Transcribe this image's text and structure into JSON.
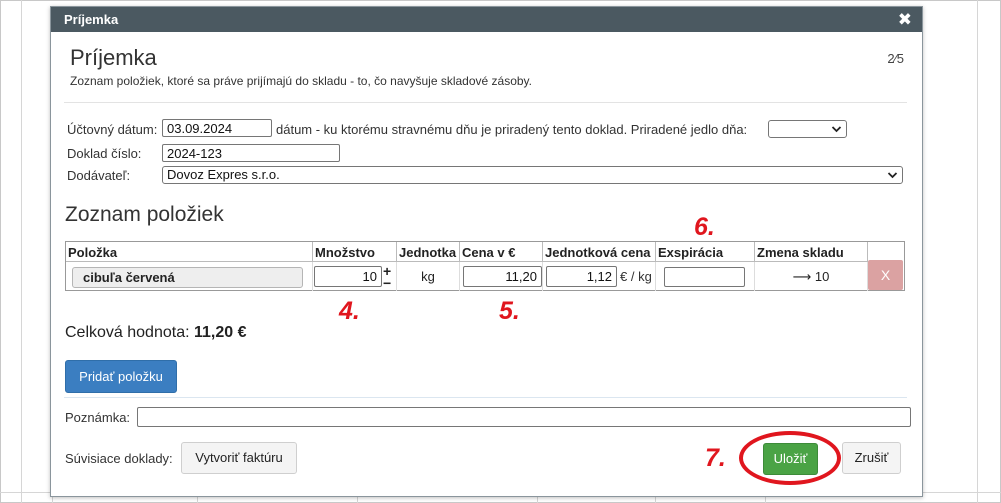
{
  "dialog": {
    "title_bar": "Príjemka",
    "close_glyph": "✖",
    "heading": "Príjemka",
    "subtitle": "Zoznam položiek, ktoré sa práve prijímajú do skladu - to, čo navyšuje skladové zásoby.",
    "step": "2⁄5"
  },
  "form": {
    "date_label": "Účtovný dátum:",
    "date_value": "03.09.2024",
    "date_hint": "dátum - ku ktorému stravnému dňu je priradený tento doklad. Priradené jedlo dňa:",
    "meal_select_value": "",
    "doc_label": "Doklad číslo:",
    "doc_value": "2024-123",
    "supplier_label": "Dodávateľ:",
    "supplier_value": "Dovoz Expres s.r.o."
  },
  "items": {
    "heading": "Zoznam položiek",
    "columns": [
      "Položka",
      "Množstvo",
      "Jednotka",
      "Cena v €",
      "Jednotková cena",
      "Exspirácia",
      "Zmena skladu"
    ],
    "rows": [
      {
        "item": "cibuľa červená",
        "quantity": "10",
        "plus": "+",
        "minus": "−",
        "unit": "kg",
        "price": "11,20",
        "unit_price": "1,12",
        "unit_price_suffix": "€ / kg",
        "expiration": "",
        "stock_change": "⟶ 10",
        "remove": "X"
      }
    ]
  },
  "annotations": {
    "n4": "4.",
    "n5": "5.",
    "n6": "6.",
    "n7": "7."
  },
  "total": {
    "label": "Celková hodnota:",
    "value": "11,20 €"
  },
  "actions": {
    "add_item": "Pridať položku",
    "note_label": "Poznámka:",
    "note_value": "",
    "related_label": "Súvisiace doklady:",
    "create_invoice": "Vytvoriť faktúru",
    "save": "Uložiť",
    "cancel": "Zrušiť"
  },
  "colors": {
    "titlebar": "#4b5961",
    "primary": "#3b7ec1",
    "success": "#4aa345",
    "danger_light": "#dba2a2",
    "annotation_red": "#e0161e"
  }
}
